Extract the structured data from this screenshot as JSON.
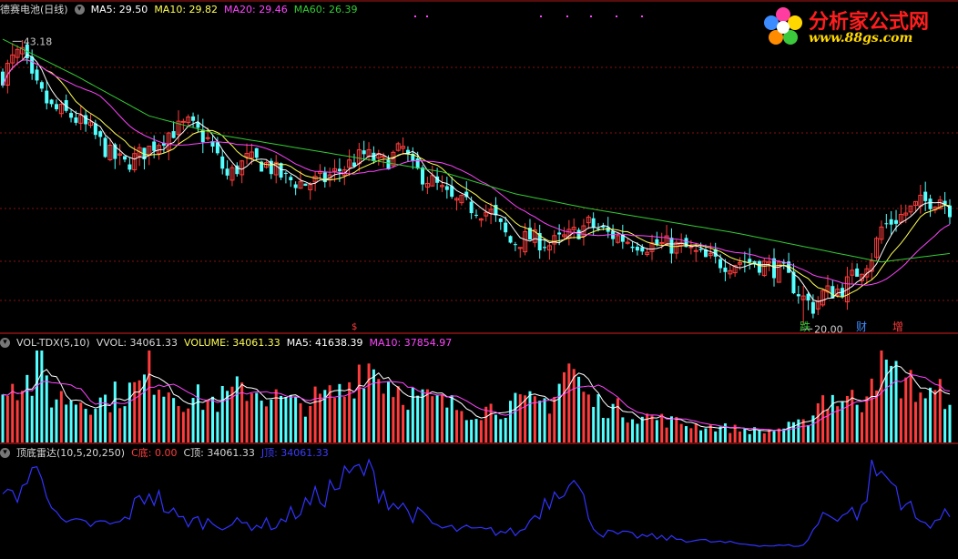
{
  "main_panel": {
    "title": "德赛电池(日线)",
    "ma5_label": "MA5: 29.50",
    "ma10_label": "MA10: 29.82",
    "ma20_label": "MA20: 29.46",
    "ma60_label": "MA60: 26.39",
    "high_label": "43.18",
    "low_label": "20.00",
    "event_markers": [
      "跌",
      "财",
      "增"
    ],
    "small_marker": "$"
  },
  "volume_panel": {
    "title": "VOL-TDX(5,10)",
    "vvol_label": "VVOL: 34061.33",
    "volume_label": "VOLUME: 34061.33",
    "ma5_label": "MA5: 41638.39",
    "ma10_label": "MA10: 37854.97"
  },
  "indicator_panel": {
    "title": "顶底雷达(10,5,20,250)",
    "cbottom_label": "C底: 0.00",
    "ctop_label": "C顶: 34061.33",
    "j_label": "J顶: 34061.33"
  },
  "logo": {
    "title": "分析家公式网",
    "url": "www.88gs.com"
  },
  "colors": {
    "up": "#ff3c3c",
    "down": "#54ffff",
    "ma5": "#ffffff",
    "ma10": "#ffff55",
    "ma20": "#ff44ff",
    "ma60": "#33cc33",
    "indicator": "#3232ff",
    "separator": "#b01818"
  },
  "chart_data": {
    "type": "candlestick",
    "price_range": [
      19.5,
      45.3
    ],
    "price_anchors": [
      [
        0,
        40.5
      ],
      [
        2,
        41.8
      ],
      [
        4,
        42.5
      ],
      [
        6,
        40.0
      ],
      [
        10,
        37.8
      ],
      [
        14,
        37.2
      ],
      [
        18,
        36.0
      ],
      [
        22,
        34.0
      ],
      [
        25,
        33.2
      ],
      [
        30,
        34.5
      ],
      [
        34,
        35.8
      ],
      [
        38,
        36.5
      ],
      [
        42,
        35.2
      ],
      [
        46,
        32.2
      ],
      [
        50,
        33.6
      ],
      [
        54,
        33.2
      ],
      [
        58,
        32.0
      ],
      [
        62,
        31.6
      ],
      [
        66,
        32.0
      ],
      [
        70,
        33.0
      ],
      [
        74,
        34.0
      ],
      [
        78,
        33.3
      ],
      [
        82,
        34.5
      ],
      [
        84,
        32.8
      ],
      [
        88,
        31.8
      ],
      [
        92,
        30.2
      ],
      [
        96,
        29.7
      ],
      [
        100,
        29.2
      ],
      [
        104,
        26.8
      ],
      [
        108,
        27.2
      ],
      [
        112,
        26.6
      ],
      [
        116,
        27.3
      ],
      [
        120,
        28.3
      ],
      [
        124,
        27.5
      ],
      [
        128,
        27.0
      ],
      [
        132,
        26.6
      ],
      [
        136,
        26.6
      ],
      [
        140,
        26.3
      ],
      [
        144,
        25.4
      ],
      [
        148,
        25.1
      ],
      [
        152,
        25.3
      ],
      [
        156,
        25.0
      ],
      [
        160,
        24.3
      ],
      [
        164,
        22.2
      ],
      [
        166,
        21.5
      ],
      [
        168,
        22.6
      ],
      [
        172,
        23.0
      ],
      [
        176,
        24.8
      ],
      [
        178,
        25.7
      ],
      [
        180,
        28.0
      ],
      [
        184,
        29.0
      ],
      [
        188,
        30.0
      ],
      [
        192,
        30.5
      ],
      [
        194,
        29.6
      ]
    ],
    "ma60_anchors": [
      [
        0,
        43.5
      ],
      [
        15,
        40.5
      ],
      [
        30,
        37.2
      ],
      [
        45,
        35.6
      ],
      [
        60,
        34.6
      ],
      [
        75,
        33.6
      ],
      [
        90,
        32.6
      ],
      [
        105,
        30.8
      ],
      [
        120,
        29.6
      ],
      [
        135,
        28.6
      ],
      [
        150,
        27.6
      ],
      [
        165,
        26.4
      ],
      [
        180,
        25.2
      ],
      [
        194,
        25.9
      ]
    ],
    "volume_anchors": [
      [
        0,
        0.7
      ],
      [
        6,
        0.65
      ],
      [
        8,
        0.9
      ],
      [
        10,
        0.5
      ],
      [
        20,
        0.45
      ],
      [
        28,
        0.6
      ],
      [
        30,
        0.8
      ],
      [
        36,
        0.5
      ],
      [
        44,
        0.45
      ],
      [
        50,
        0.6
      ],
      [
        60,
        0.4
      ],
      [
        70,
        0.55
      ],
      [
        74,
        0.9
      ],
      [
        78,
        0.7
      ],
      [
        84,
        0.5
      ],
      [
        96,
        0.35
      ],
      [
        112,
        0.45
      ],
      [
        116,
        0.85
      ],
      [
        120,
        0.45
      ],
      [
        130,
        0.3
      ],
      [
        140,
        0.2
      ],
      [
        156,
        0.12
      ],
      [
        164,
        0.2
      ],
      [
        168,
        0.5
      ],
      [
        176,
        0.45
      ],
      [
        178,
        0.85
      ],
      [
        182,
        0.75
      ],
      [
        190,
        0.5
      ],
      [
        194,
        0.55
      ]
    ],
    "indicator_anchors": [
      [
        0,
        0.55
      ],
      [
        8,
        0.95
      ],
      [
        12,
        0.3
      ],
      [
        24,
        0.3
      ],
      [
        30,
        0.7
      ],
      [
        36,
        0.35
      ],
      [
        48,
        0.3
      ],
      [
        56,
        0.3
      ],
      [
        74,
        0.95
      ],
      [
        80,
        0.55
      ],
      [
        90,
        0.25
      ],
      [
        106,
        0.2
      ],
      [
        116,
        0.9
      ],
      [
        122,
        0.2
      ],
      [
        140,
        0.12
      ],
      [
        156,
        0.05
      ],
      [
        164,
        0.05
      ],
      [
        168,
        0.4
      ],
      [
        176,
        0.45
      ],
      [
        178,
        0.95
      ],
      [
        182,
        0.8
      ],
      [
        188,
        0.3
      ],
      [
        194,
        0.4
      ]
    ]
  }
}
